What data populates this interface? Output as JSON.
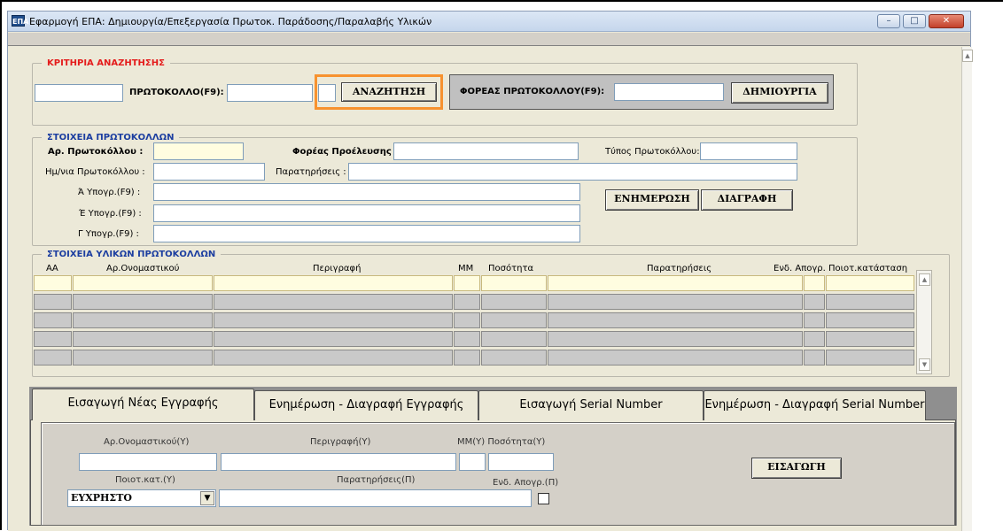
{
  "window": {
    "title": "Εφαρμογή ΕΠΑ: Δημιουργία/Επεξεργασία Πρωτοκ. Παράδοσης/Παραλαβής Υλικών",
    "app_icon": "ΕΠΑ",
    "min": "–",
    "max": "□",
    "close": "✕"
  },
  "search": {
    "legend": "ΚΡΙΤΗΡΙΑ ΑΝΑΖΗΤΗΣΗΣ",
    "protocol_label": "ΠΡΩΤΟΚΟΛΛΟ(F9):",
    "search_button": "ΑΝΑΖΗΤΗΣΗ",
    "foreas_label": "ΦΟΡΕΑΣ ΠΡΩΤΟΚΟΛΛΟΥ(F9):",
    "create_button": "ΔΗΜΙΟΥΡΓΙΑ"
  },
  "protocol": {
    "legend": "ΣΤΟΙΧΕΙΑ ΠΡΩΤΟΚΟΛΛΩΝ",
    "number_label": "Αρ. Πρωτοκόλλου :",
    "foreas_label": "Φορέας Προέλευσης :",
    "type_label": "Τύπος Πρωτοκόλλου:",
    "date_label": "Ημ/νια Πρωτοκόλλου :",
    "notes_label": "Παρατηρήσεις :",
    "sign_a": "Ά Υπογρ.(F9) :",
    "sign_b": "Έ Υπογρ.(F9) :",
    "sign_c": "Γ Υπογρ.(F9) :",
    "update_button": "ΕΝΗΜΕΡΩΣΗ",
    "delete_button": "ΔΙΑΓΡΑΦΗ"
  },
  "materials": {
    "legend": "ΣΤΟΙΧΕΙΑ ΥΛΙΚΩΝ ΠΡΩΤΟΚΟΛΛΩΝ",
    "columns": [
      "ΑΑ",
      "Αρ.Ονομαστικού",
      "Περιγραφή",
      "ΜΜ",
      "Ποσότητα",
      "Παρατηρήσεις",
      "Ενδ. Απογρ.",
      "Ποιοτ.κατάσταση"
    ],
    "scroll_up": "▲",
    "scroll_down": "▼"
  },
  "tabs": [
    "Εισαγωγή Νέας Εγγραφής",
    "Ενημέρωση - Διαγραφή Εγγραφής",
    "Εισαγωγή Serial Number",
    "Ενημέρωση - Διαγραφή Serial Number"
  ],
  "entry": {
    "onomastikou_label": "Αρ.Ονομαστικού(Υ)",
    "perigrafi_label": "Περιγραφή(Υ)",
    "mm_qty_label": "ΜΜ(Υ) Ποσότητα(Υ)",
    "poiot_label": "Ποιοτ.κατ.(Υ)",
    "notes_label": "Παρατηρήσεις(Π)",
    "end_label": "Ενδ. Απογρ.(Π)",
    "poiot_value": "ΕΥΧΡΗΣΤΟ",
    "insert_button": "ΕΙΣΑΓΩΓΗ"
  }
}
